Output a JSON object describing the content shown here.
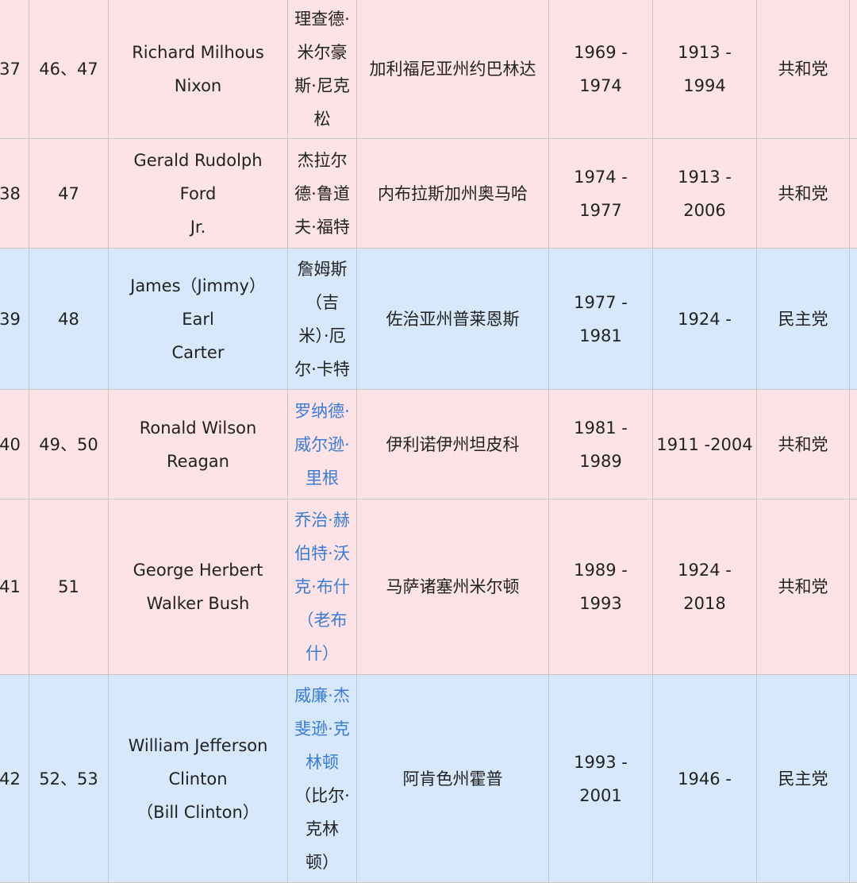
{
  "colors": {
    "republican_row": "#fde3e6",
    "democratic_row": "#d7e8fc",
    "link": "#3a7bd5",
    "border": "#c8c8c8"
  },
  "rows": [
    {
      "no": "37",
      "term": "46、47",
      "name_en": [
        "Richard Milhous",
        "Nixon"
      ],
      "name_cn": [
        [
          "理查德·",
          false
        ],
        [
          "米尔豪",
          false
        ],
        [
          "斯·尼克",
          false
        ],
        [
          "松",
          false
        ]
      ],
      "birthplace": "加利福尼亚州约巴林达",
      "tenure": "1969 - 1974",
      "life": [
        "1913 - 1994"
      ],
      "party": "共和党"
    },
    {
      "no": "38",
      "term": "47",
      "name_en": [
        "Gerald Rudolph Ford",
        "Jr."
      ],
      "name_cn": [
        [
          "杰拉尔",
          false
        ],
        [
          "德·鲁道",
          false
        ],
        [
          "夫·福特",
          false
        ]
      ],
      "birthplace": "内布拉斯加州奥马哈",
      "tenure": "1974 - 1977",
      "life": [
        "1913 - 2006"
      ],
      "party": "共和党"
    },
    {
      "no": "39",
      "term": "48",
      "name_en": [
        "James（Jimmy） Earl",
        "Carter"
      ],
      "name_cn": [
        [
          "詹姆斯",
          false
        ],
        [
          "（吉",
          false
        ],
        [
          "米）·厄",
          false
        ],
        [
          "尔·卡特",
          false
        ]
      ],
      "birthplace": "佐治亚州普莱恩斯",
      "tenure": "1977 - 1981",
      "life": [
        "1924 -"
      ],
      "party": "民主党"
    },
    {
      "no": "40",
      "term": "49、50",
      "name_en": [
        "Ronald Wilson",
        "Reagan"
      ],
      "name_cn": [
        [
          "罗纳德·",
          true
        ],
        [
          "威尔逊·",
          true
        ],
        [
          "里根",
          true
        ]
      ],
      "birthplace": "伊利诺伊州坦皮科",
      "tenure": "1981 - 1989",
      "life": [
        "1911  -2004"
      ],
      "party": "共和党"
    },
    {
      "no": "41",
      "term": "51",
      "name_en": [
        "George Herbert",
        "Walker Bush"
      ],
      "name_cn": [
        [
          "乔治·赫",
          true
        ],
        [
          "伯特·沃",
          true
        ],
        [
          "克·布什",
          true
        ],
        [
          "（老布",
          true
        ],
        [
          "什）",
          true
        ]
      ],
      "birthplace": "马萨诸塞州米尔顿",
      "tenure": "1989 - 1993",
      "life": [
        "1924 -",
        "2018"
      ],
      "party": "共和党"
    },
    {
      "no": "42",
      "term": "52、53",
      "name_en": [
        "William Jefferson",
        "Clinton",
        "（Bill Clinton）"
      ],
      "name_cn": [
        [
          "威廉·杰",
          true
        ],
        [
          "斐逊·克",
          true
        ],
        [
          "林顿",
          true
        ],
        [
          "（比尔·",
          false
        ],
        [
          "克林",
          false
        ],
        [
          "顿）",
          false
        ]
      ],
      "birthplace": "阿肯色州霍普",
      "tenure": "1993 - 2001",
      "life": [
        "1946 -"
      ],
      "party": "民主党"
    }
  ]
}
